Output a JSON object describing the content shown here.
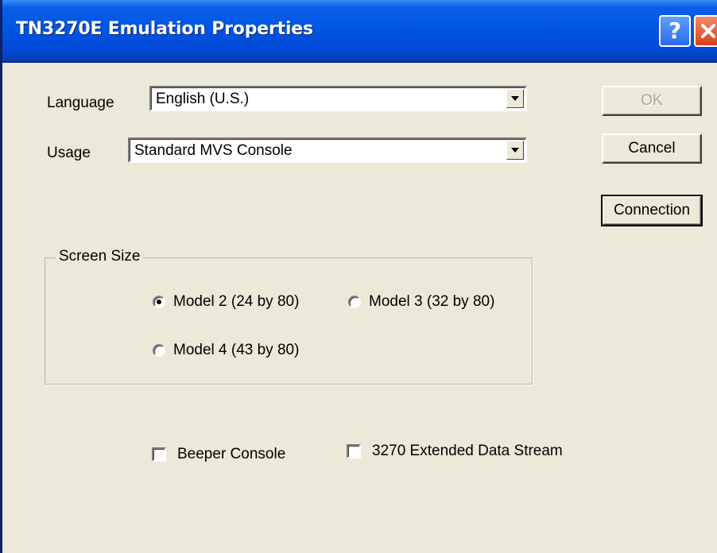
{
  "window": {
    "title": "TN3270E Emulation Properties",
    "help_glyph": "?",
    "close_glyph": "close-icon"
  },
  "language": {
    "label": "Language",
    "value": "English (U.S.)"
  },
  "usage": {
    "label": "Usage",
    "value": "Standard MVS Console"
  },
  "buttons": {
    "ok": "OK",
    "cancel": "Cancel",
    "connection": "Connection"
  },
  "screen_size": {
    "legend": "Screen Size",
    "options": [
      {
        "label": "Model 2 (24 by 80)",
        "selected": true
      },
      {
        "label": "Model 3 (32 by 80)",
        "selected": false
      },
      {
        "label": "Model 4 (43 by 80)",
        "selected": false
      }
    ]
  },
  "options": {
    "beeper_console": {
      "label": "Beeper Console",
      "checked": false
    },
    "extended_data_stream": {
      "label": "3270 Extended Data Stream",
      "checked": false
    }
  },
  "colors": {
    "title_bar": "#0054e3",
    "dialog_bg": "#ece9d8",
    "close_button": "#d8401e",
    "disabled_text": "#a7a597"
  }
}
